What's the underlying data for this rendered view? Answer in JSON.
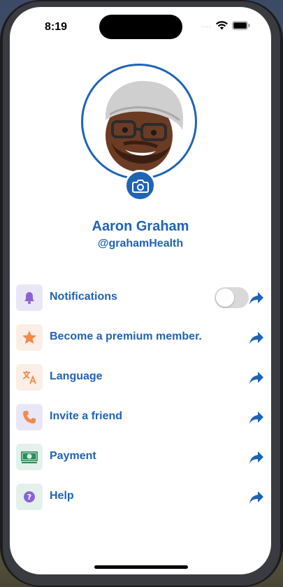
{
  "status_bar": {
    "time": "8:19",
    "signal": "....",
    "wifi_icon": "wifi-icon",
    "battery_icon": "battery-icon"
  },
  "profile": {
    "name": "Aaron Graham",
    "handle": "@grahamHealth",
    "avatar_icon": "memoji-avatar",
    "camera_icon": "camera-icon",
    "accent_color": "#1f63b5"
  },
  "menu": {
    "items": [
      {
        "label": "Notifications",
        "icon": "bell-icon",
        "icon_bg": "#e9e6f7",
        "has_toggle": true,
        "toggle_on": false
      },
      {
        "label": "Become a premium member.",
        "icon": "star-icon",
        "icon_bg": "#fbeee6"
      },
      {
        "label": "Language",
        "icon": "translate-icon",
        "icon_bg": "#fbeee6"
      },
      {
        "label": "Invite a friend",
        "icon": "phone-icon",
        "icon_bg": "#e9e6f7"
      },
      {
        "label": "Payment",
        "icon": "money-icon",
        "icon_bg": "#e3f1ea"
      },
      {
        "label": "Help",
        "icon": "help-icon",
        "icon_bg": "#e3f1ea"
      }
    ],
    "arrow_icon": "share-arrow-icon"
  }
}
